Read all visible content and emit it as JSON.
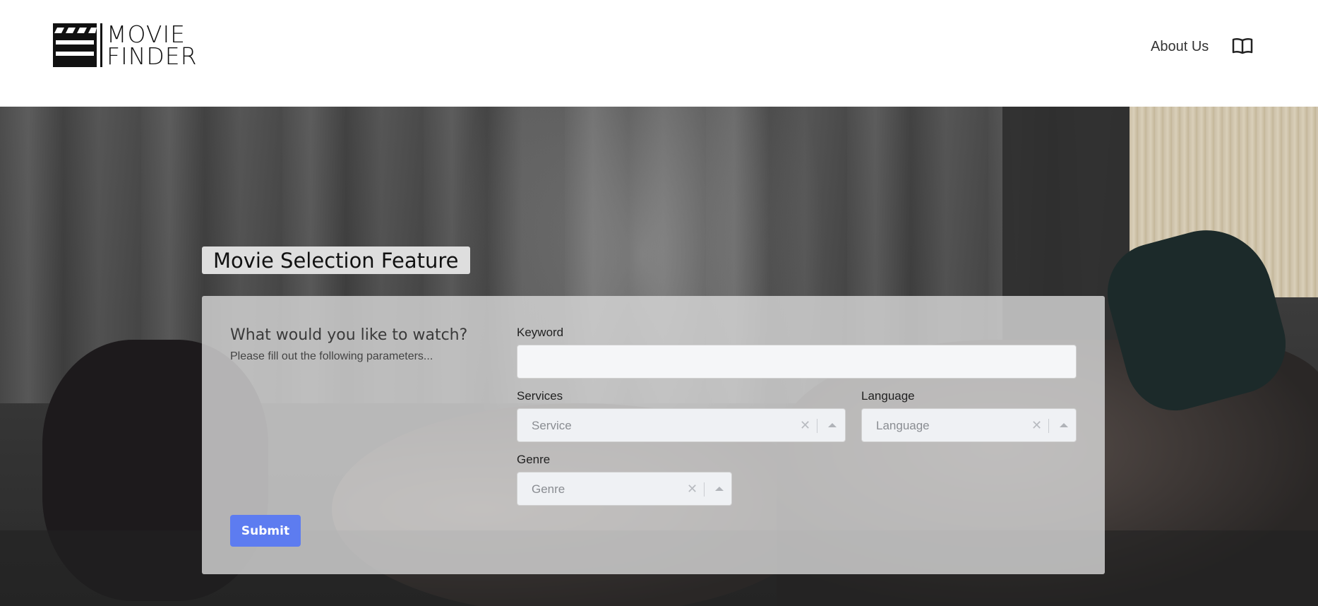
{
  "brand": {
    "line1": "MOVIE",
    "line2": "FINDER"
  },
  "nav": {
    "about": "About Us",
    "book_icon": "book-open-icon"
  },
  "hero": {
    "title": "Movie Selection Feature"
  },
  "form": {
    "heading": "What would you like to watch?",
    "subheading": "Please fill out the following parameters...",
    "keyword": {
      "label": "Keyword",
      "value": "",
      "placeholder": ""
    },
    "services": {
      "label": "Services",
      "placeholder": "Service"
    },
    "language": {
      "label": "Language",
      "placeholder": "Language"
    },
    "genre": {
      "label": "Genre",
      "placeholder": "Genre"
    },
    "submit_label": "Submit"
  },
  "colors": {
    "accent": "#5d7cf0",
    "panel": "#d6d6d6"
  }
}
